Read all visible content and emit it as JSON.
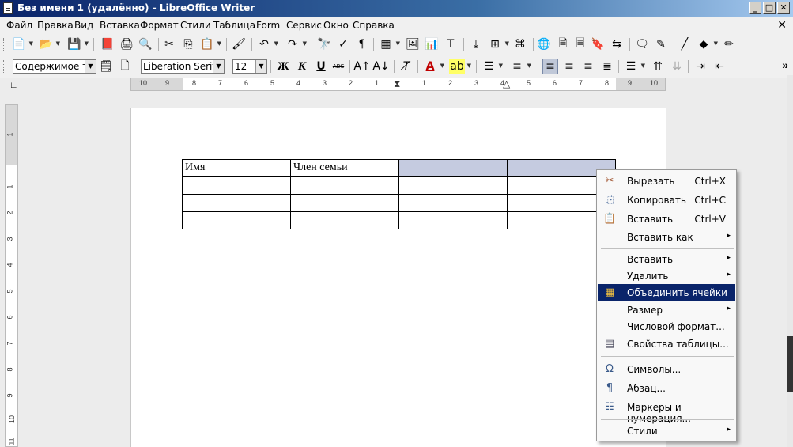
{
  "window": {
    "title": "Без имени 1 (удалённо) - LibreOffice Writer",
    "min_glyph": "_",
    "max_glyph": "□",
    "close_glyph": "✕"
  },
  "menubar": {
    "items": [
      "Файл",
      "Правка",
      "Вид",
      "Вставка",
      "Формат",
      "Стили",
      "Таблица",
      "Form",
      "Сервис",
      "Окно",
      "Справка"
    ],
    "close_doc": "✕"
  },
  "formatting": {
    "paragraph_style": "Содержимое таб.",
    "font_name": "Liberation Serif",
    "font_size": "12",
    "bold": "Ж",
    "italic": "К",
    "underline": "U",
    "strike": "ABC",
    "more": "»"
  },
  "hruler": {
    "numbers": [
      "10",
      "9",
      "8",
      "7",
      "6",
      "5",
      "4",
      "3",
      "2",
      "1",
      "1",
      "2",
      "3",
      "4",
      "5",
      "6",
      "7",
      "8",
      "9",
      "10"
    ]
  },
  "vruler": {
    "numbers": [
      "1",
      "1",
      "2",
      "3",
      "4",
      "5",
      "6",
      "7",
      "8",
      "9",
      "10",
      "11"
    ]
  },
  "table": {
    "rows": [
      [
        "Имя",
        "Член семьи",
        "",
        ""
      ],
      [
        "",
        "",
        "",
        ""
      ],
      [
        "",
        "",
        "",
        ""
      ],
      [
        "",
        "",
        "",
        ""
      ]
    ],
    "highlight_color": "#c5cbe0"
  },
  "context_menu": {
    "cut": {
      "label": "Вырезать",
      "shortcut": "Ctrl+X"
    },
    "copy": {
      "label": "Копировать",
      "shortcut": "Ctrl+C"
    },
    "paste": {
      "label": "Вставить",
      "shortcut": "Ctrl+V"
    },
    "paste_special": {
      "label": "Вставить как",
      "submenu": "▸"
    },
    "insert": {
      "label": "Вставить",
      "submenu": "▸"
    },
    "delete": {
      "label": "Удалить",
      "submenu": "▸"
    },
    "merge_cells": {
      "label": "Объединить ячейки"
    },
    "size": {
      "label": "Размер",
      "submenu": "▸"
    },
    "number_format": {
      "label": "Числовой формат..."
    },
    "table_properties": {
      "label": "Свойства таблицы..."
    },
    "symbols": {
      "label": "Символы..."
    },
    "paragraph": {
      "label": "Абзац..."
    },
    "bullets": {
      "label": "Маркеры и нумерация..."
    },
    "styles": {
      "label": "Стили",
      "submenu": "▸"
    },
    "active_color": "#0a246a"
  }
}
